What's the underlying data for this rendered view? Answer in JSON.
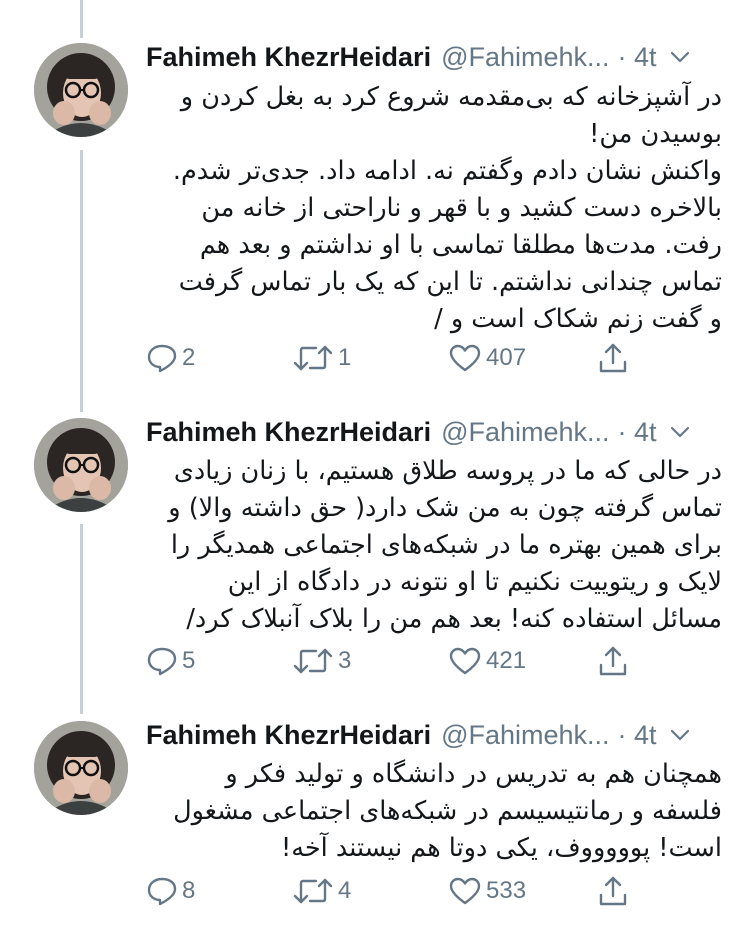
{
  "colors": {
    "text": "#14171a",
    "secondary": "#657786",
    "thread_line": "#c4cfd6",
    "icon": "#657786"
  },
  "tweets": [
    {
      "name": "Fahimeh KhezrHeidari",
      "handle": "@Fahimehk...",
      "time": "· 4t",
      "lines": [
        "در آشپزخانه که بی‌مقدمه شروع کرد به بغل کردن و",
        "بوسیدن من!",
        "واکنش نشان دادم وگفتم نه. ادامه داد. جدی‌تر شدم.",
        "بالاخره دست کشید و با قهر و ناراحتی از خانه من",
        "رفت. مدت‌ها مطلقا تماسی با او نداشتم و بعد هم",
        "تماس چندانی نداشتم. تا این که یک بار تماس گرفت",
        "و گفت زنم شکاک است و /"
      ],
      "replies": "2",
      "retweets": "1",
      "likes": "407"
    },
    {
      "name": "Fahimeh KhezrHeidari",
      "handle": "@Fahimehk...",
      "time": "· 4t",
      "lines": [
        "در حالی که ما در پروسه طلاق هستیم، با زنان زیادی",
        "تماس گرفته چون به من شک دارد( حق داشته والا) و",
        "برای همین بهتره ما در شبکه‌های اجتماعی همدیگر را",
        "لایک و ریتوییت نکنیم تا او نتونه در دادگاه از این",
        "مسائل استفاده کنه! بعد هم من را بلاک آنبلاک کرد/"
      ],
      "replies": "5",
      "retweets": "3",
      "likes": "421"
    },
    {
      "name": "Fahimeh KhezrHeidari",
      "handle": "@Fahimehk...",
      "time": "· 4t",
      "lines": [
        "همچنان هم به تدریس در دانشگاه و تولید فکر و",
        "فلسفه و رمانتیسیسم در شبکه‌های اجتماعی مشغول",
        "است! پوووووف، یکی دوتا هم نیستند آخه!"
      ],
      "replies": "8",
      "retweets": "4",
      "likes": "533"
    }
  ]
}
